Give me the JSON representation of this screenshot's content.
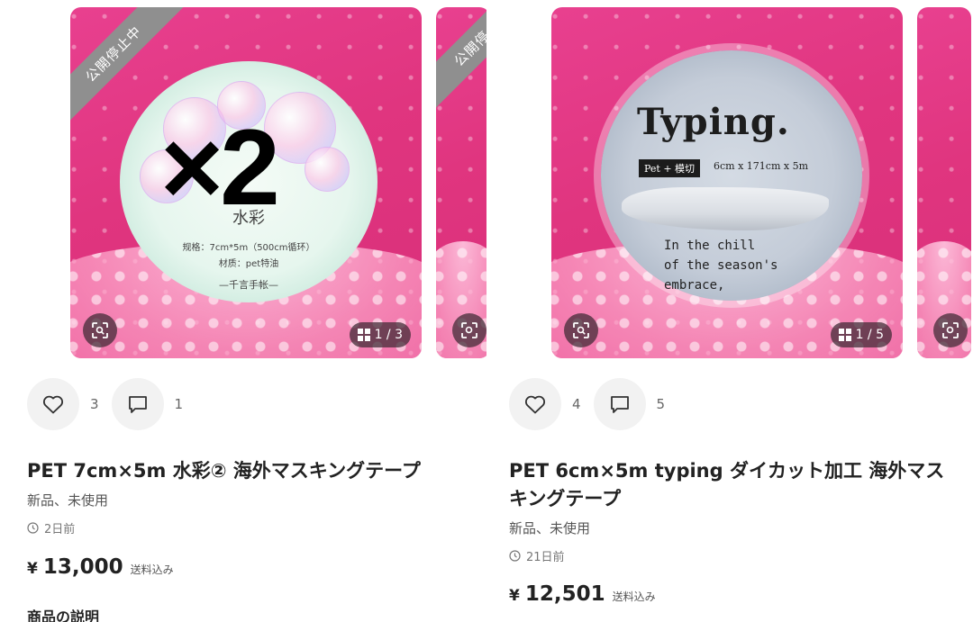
{
  "products": [
    {
      "status_ribbon": "公開停止中",
      "image_counter": "1 / 3",
      "tape_text": {
        "name": "水彩",
        "spec": "规格：7cm*5m（500cm循环）",
        "material": "材质：pet特油",
        "brand": "—千言手帐—"
      },
      "overlay_text": "×2",
      "likes": "3",
      "comments": "1",
      "title": "PET 7cm×5m 水彩② 海外マスキングテープ",
      "condition": "新品、未使用",
      "posted": "2日前",
      "price_symbol": "¥",
      "price": "13,000",
      "shipping": "送料込み",
      "description_heading": "商品の説明"
    },
    {
      "image_counter": "1 / 5",
      "tape_text": {
        "title": "Typing.",
        "tag": "Pet + 模切",
        "spec": "6cm x 171cm x 5m",
        "line1": "In the chill",
        "line2": "of the season's",
        "line3": "embrace,"
      },
      "likes": "4",
      "comments": "5",
      "title": "PET 6cm×5m typing ダイカット加工 海外マスキングテープ",
      "condition": "新品、未使用",
      "posted": "21日前",
      "price_symbol": "¥",
      "price": "12,501",
      "shipping": "送料込み"
    }
  ],
  "peek_ribbon": "公開停"
}
